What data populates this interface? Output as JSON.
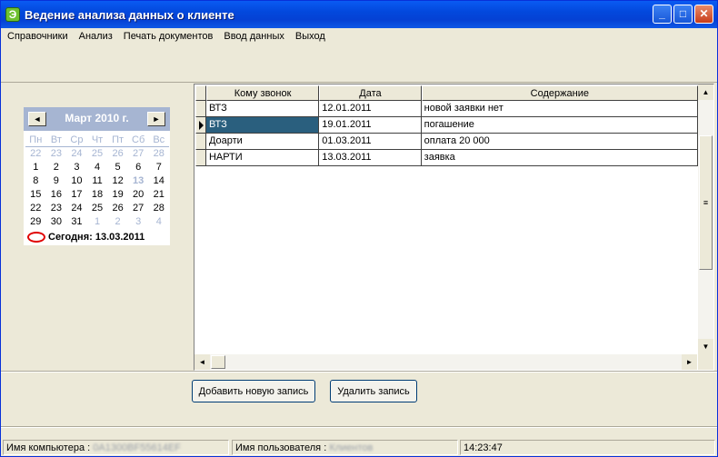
{
  "window": {
    "title": "Ведение анализа данных о клиенте",
    "icon_name": "app-icon",
    "controls": [
      "minimize-icon",
      "maximize-icon",
      "close-icon"
    ]
  },
  "menu": {
    "items": [
      "Справочники",
      "Анализ",
      "Печать документов",
      "Ввод данных",
      "Выход"
    ]
  },
  "calendar": {
    "title": "Март 2010 г.",
    "prev": "◄",
    "next": "►",
    "weekdays": [
      "Пн",
      "Вт",
      "Ср",
      "Чт",
      "Пт",
      "Сб",
      "Вс"
    ],
    "weeks": [
      [
        "22",
        "23",
        "24",
        "25",
        "26",
        "27",
        "28"
      ],
      [
        "1",
        "2",
        "3",
        "4",
        "5",
        "6",
        "7"
      ],
      [
        "8",
        "9",
        "10",
        "11",
        "12",
        "13",
        "14"
      ],
      [
        "15",
        "16",
        "17",
        "18",
        "19",
        "20",
        "21"
      ],
      [
        "22",
        "23",
        "24",
        "25",
        "26",
        "27",
        "28"
      ],
      [
        "29",
        "30",
        "31",
        "1",
        "2",
        "3",
        "4"
      ]
    ],
    "today_label": "Сегодня: 13.03.2011"
  },
  "grid": {
    "columns": [
      "Кому звонок",
      "Дата",
      "Содержание"
    ],
    "rows": [
      [
        "ВТЗ",
        "12.01.2011",
        "новой заявки нет"
      ],
      [
        "ВТЗ",
        "19.01.2011",
        "погашение"
      ],
      [
        "Доарти",
        "01.03.2011",
        "оплата 20 000"
      ],
      [
        "НАРТИ",
        "13.03.2011",
        "заявка"
      ]
    ],
    "current_row": 1
  },
  "buttons": {
    "add": "Добавить новую запись",
    "delete": "Удалить запись"
  },
  "status": {
    "computer_label": "Имя компьютера :",
    "computer_value": "0A1300BF55614EF",
    "user_label": "Имя пользователя :",
    "user_value": "Клиентов",
    "time": "14:23:47"
  }
}
